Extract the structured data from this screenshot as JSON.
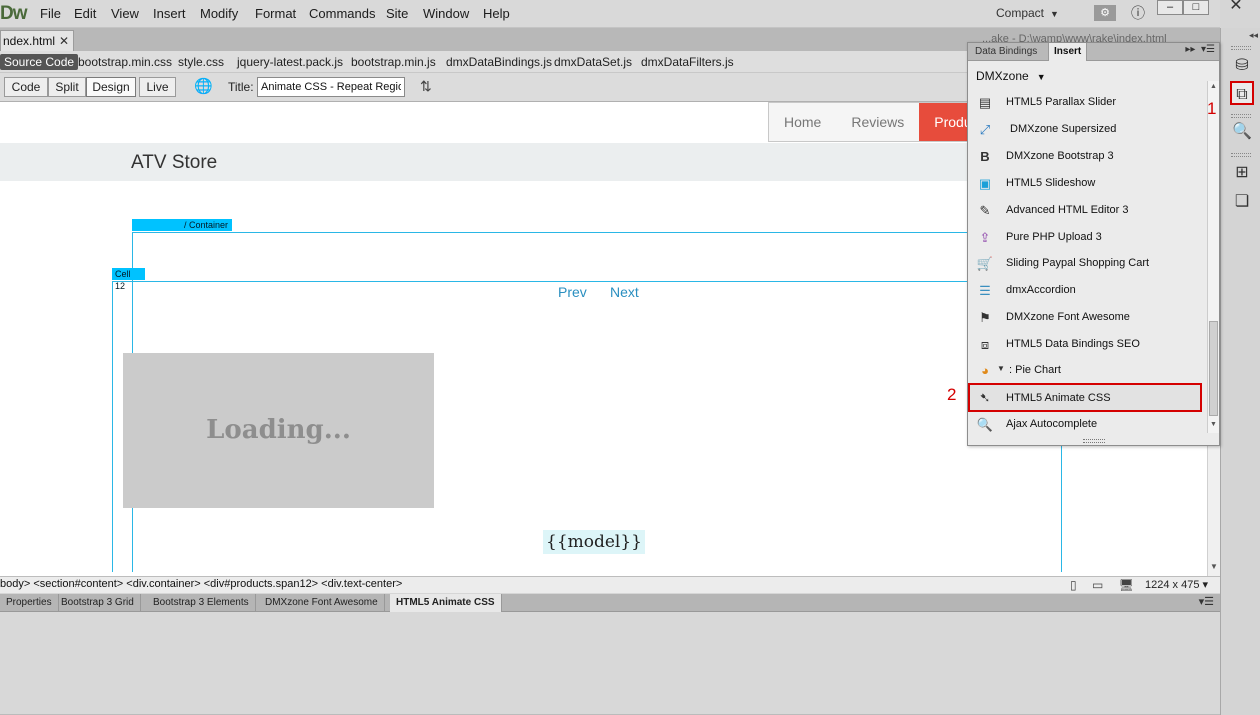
{
  "app": {
    "logo": "Dw"
  },
  "menu": [
    "File",
    "Edit",
    "View",
    "Insert",
    "Modify",
    "Format",
    "Commands",
    "Site",
    "Window",
    "Help"
  ],
  "workspace": {
    "label": "Compact"
  },
  "document": {
    "tab_label": "ndex.html",
    "path_title": "...ake - D:\\wamp\\www\\rake\\index.html"
  },
  "related_files": [
    "Source Code",
    "bootstrap.min.css",
    "style.css",
    "jquery-latest.pack.js",
    "bootstrap.min.js",
    "dmxDataBindings.js",
    "dmxDataSet.js",
    "dmxDataFilters.js"
  ],
  "doc_toolbar": {
    "views": [
      "Code",
      "Split",
      "Design",
      "Live"
    ],
    "active_view": "Design",
    "title_label": "Title:",
    "title_value": "Animate CSS - Repeat Region"
  },
  "design": {
    "brand": "ATV Store",
    "nav": [
      "Home",
      "Reviews",
      "Produ"
    ],
    "active_nav": "Produ",
    "container_tag": "/ Container",
    "cell_tag": "Cell 12",
    "prev": "Prev",
    "next": "Next",
    "loading": "Loading...",
    "model": "{{model}}"
  },
  "status": {
    "tag_path": "body> <section#content> <div.container> <div#products.span12> <div.text-center>",
    "dimensions": "1224 x 475"
  },
  "property_tabs": [
    "Properties",
    "Bootstrap 3 Grid",
    "Bootstrap 3 Elements",
    "DMXzone Font Awesome",
    "HTML5 Animate CSS"
  ],
  "active_property_tab": "HTML5 Animate CSS",
  "insert_panel": {
    "tabs": [
      "Data Bindings",
      "Insert"
    ],
    "active_tab": "Insert",
    "category": "DMXzone",
    "items": [
      {
        "label": "HTML5 Parallax Slider",
        "icon": "parallax-slider-icon"
      },
      {
        "label": "DMXzone Supersized",
        "icon": "supersized-icon"
      },
      {
        "label": "DMXzone Bootstrap 3",
        "icon": "bootstrap-icon"
      },
      {
        "label": "HTML5 Slideshow",
        "icon": "slideshow-icon"
      },
      {
        "label": "Advanced HTML Editor 3",
        "icon": "html-editor-icon"
      },
      {
        "label": "Pure PHP Upload 3",
        "icon": "php-upload-icon"
      },
      {
        "label": "Sliding Paypal Shopping Cart",
        "icon": "shopping-cart-icon"
      },
      {
        "label": "dmxAccordion",
        "icon": "accordion-icon"
      },
      {
        "label": "DMXzone Font Awesome",
        "icon": "font-awesome-flag-icon"
      },
      {
        "label": "HTML5 Data Bindings SEO",
        "icon": "data-bindings-icon"
      },
      {
        "label": ": Pie Chart",
        "icon": "pie-chart-icon"
      },
      {
        "label": "HTML5 Animate CSS",
        "icon": "animate-css-icon"
      },
      {
        "label": "Ajax Autocomplete",
        "icon": "autocomplete-search-icon"
      }
    ],
    "selected": "HTML5 Animate CSS"
  },
  "annotations": {
    "marker_1": "1",
    "marker_2": "2"
  },
  "colors": {
    "highlight": "#d40000",
    "guide": "#2ab7e6",
    "nav_active": "#e74c3c"
  }
}
